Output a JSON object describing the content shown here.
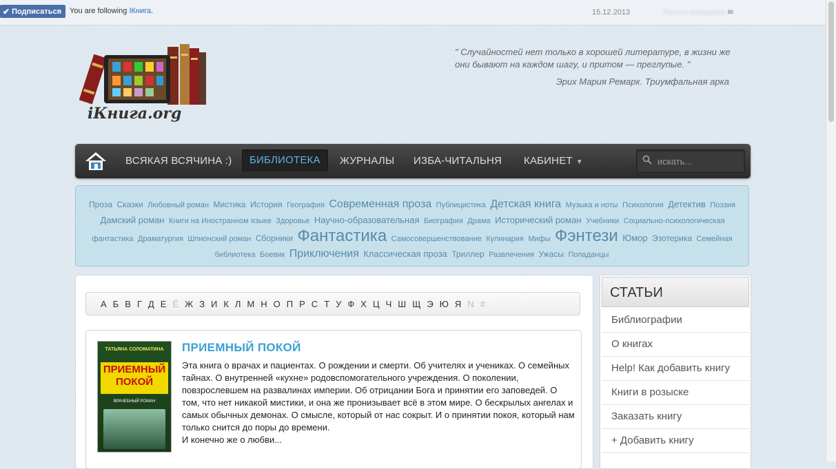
{
  "topbar": {
    "subscribe_label": "Подписаться",
    "following_prefix": "You are following ",
    "blog_name": "IКнига",
    "following_suffix": ".",
    "date": "15.12.2013",
    "messages_label": "Личные сообщения"
  },
  "logo": {
    "text": "iКнига.org"
  },
  "quote": {
    "text": "\" Случайностей нет только в хорошей литературе, в жизни же они бывают на каждом шагу, и притом — преглупые. \"",
    "author": "Эрих Мария Ремарк. Триумфальная арка"
  },
  "nav": {
    "items": [
      {
        "label": "Всякая всячина :)"
      },
      {
        "label": "Библиотека",
        "active": true
      },
      {
        "label": "Журналы"
      },
      {
        "label": "Изба-читальня"
      },
      {
        "label": "Кабинет"
      }
    ],
    "search_placeholder": "искать..."
  },
  "tags": [
    {
      "label": "Проза",
      "size": 2
    },
    {
      "label": "Сказки",
      "size": 2
    },
    {
      "label": "Любовный роман",
      "size": 1
    },
    {
      "label": "Мистика",
      "size": 2
    },
    {
      "label": "История",
      "size": 2
    },
    {
      "label": "География",
      "size": 1
    },
    {
      "label": "Современная проза",
      "size": 4
    },
    {
      "label": "Публицистика",
      "size": 1
    },
    {
      "label": "Детская книга",
      "size": 4
    },
    {
      "label": "Музыка и ноты",
      "size": 1
    },
    {
      "label": "Психология",
      "size": 1
    },
    {
      "label": "Детектив",
      "size": 3
    },
    {
      "label": "Поэзия",
      "size": 1
    },
    {
      "label": "Дамский роман",
      "size": 3
    },
    {
      "label": "Книги на Иностранном языке",
      "size": 1
    },
    {
      "label": "Здоровье",
      "size": 1
    },
    {
      "label": "Научно-образовательная",
      "size": 3
    },
    {
      "label": "Биография",
      "size": 1
    },
    {
      "label": "Драма",
      "size": 1
    },
    {
      "label": "Исторический роман",
      "size": 3
    },
    {
      "label": "Учебники",
      "size": 1
    },
    {
      "label": "Социально-психологическая фантастика",
      "size": 1
    },
    {
      "label": "Драматургия",
      "size": 1
    },
    {
      "label": "Шпионский роман",
      "size": 1
    },
    {
      "label": "Сборники",
      "size": 2
    },
    {
      "label": "Фантастика",
      "size": 5
    },
    {
      "label": "Самосовершенствование",
      "size": 1
    },
    {
      "label": "Кулинария",
      "size": 1
    },
    {
      "label": "Мифы",
      "size": 1
    },
    {
      "label": "Фэнтези",
      "size": 5
    },
    {
      "label": "Юмор",
      "size": 3
    },
    {
      "label": "Эзотерика",
      "size": 2
    },
    {
      "label": "Семейная библиотека",
      "size": 1
    },
    {
      "label": "Боевик",
      "size": 1
    },
    {
      "label": "Приключения",
      "size": 4
    },
    {
      "label": "Классическая проза",
      "size": 3
    },
    {
      "label": "Триллер",
      "size": 2
    },
    {
      "label": "Развлечения",
      "size": 1
    },
    {
      "label": "Ужасы",
      "size": 2
    },
    {
      "label": "Попаданцы",
      "size": 1
    }
  ],
  "alphabet": [
    {
      "l": "А"
    },
    {
      "l": "Б"
    },
    {
      "l": "В"
    },
    {
      "l": "Г"
    },
    {
      "l": "Д"
    },
    {
      "l": "Е"
    },
    {
      "l": "Ё",
      "dim": true
    },
    {
      "l": "Ж"
    },
    {
      "l": "З"
    },
    {
      "l": "И"
    },
    {
      "l": "К"
    },
    {
      "l": "Л"
    },
    {
      "l": "М"
    },
    {
      "l": "Н"
    },
    {
      "l": "О"
    },
    {
      "l": "П"
    },
    {
      "l": "Р"
    },
    {
      "l": "С"
    },
    {
      "l": "Т"
    },
    {
      "l": "У"
    },
    {
      "l": "Ф"
    },
    {
      "l": "Х"
    },
    {
      "l": "Ц"
    },
    {
      "l": "Ч"
    },
    {
      "l": "Ш"
    },
    {
      "l": "Щ"
    },
    {
      "l": "Э"
    },
    {
      "l": "Ю"
    },
    {
      "l": "Я"
    },
    {
      "l": "N",
      "dim": true
    },
    {
      "l": "#",
      "dim": true
    }
  ],
  "book": {
    "title": "Приемный покой",
    "cover_author": "ТАТЬЯНА СОЛОМАТИНА",
    "cover_title": "ПРИЕМНЫЙ ПОКОЙ",
    "cover_sub": "ВРАЧЕБНЫЙ РОМАН",
    "description": "Эта книга о врачах и пациентах. О рождении и смерти. Об учителях и учениках. О семейных тайнах. О внутренней «кухне» родовспомогательного учреждения. О поколении, повзрослевшем на развалинах империи. Об отрицании Бога и принятии его заповедей. О том, что нет никакой мистики, и она же пронизывает всё в этом мире. О бескрылых ангелах и самых обычных демонах. О смысле, который от нас сокрыт. И о принятии покоя, который нам только снится до поры до времени.",
    "description_end": "И конечно же о любви..."
  },
  "sidebar": {
    "title": "Статьи",
    "items": [
      {
        "label": "Библиографии"
      },
      {
        "label": "О книгах"
      },
      {
        "label": "Help! Как добавить книгу"
      },
      {
        "label": "Книги в розыске"
      },
      {
        "label": "Заказать книгу"
      },
      {
        "label": "+ Добавить книгу"
      }
    ]
  }
}
